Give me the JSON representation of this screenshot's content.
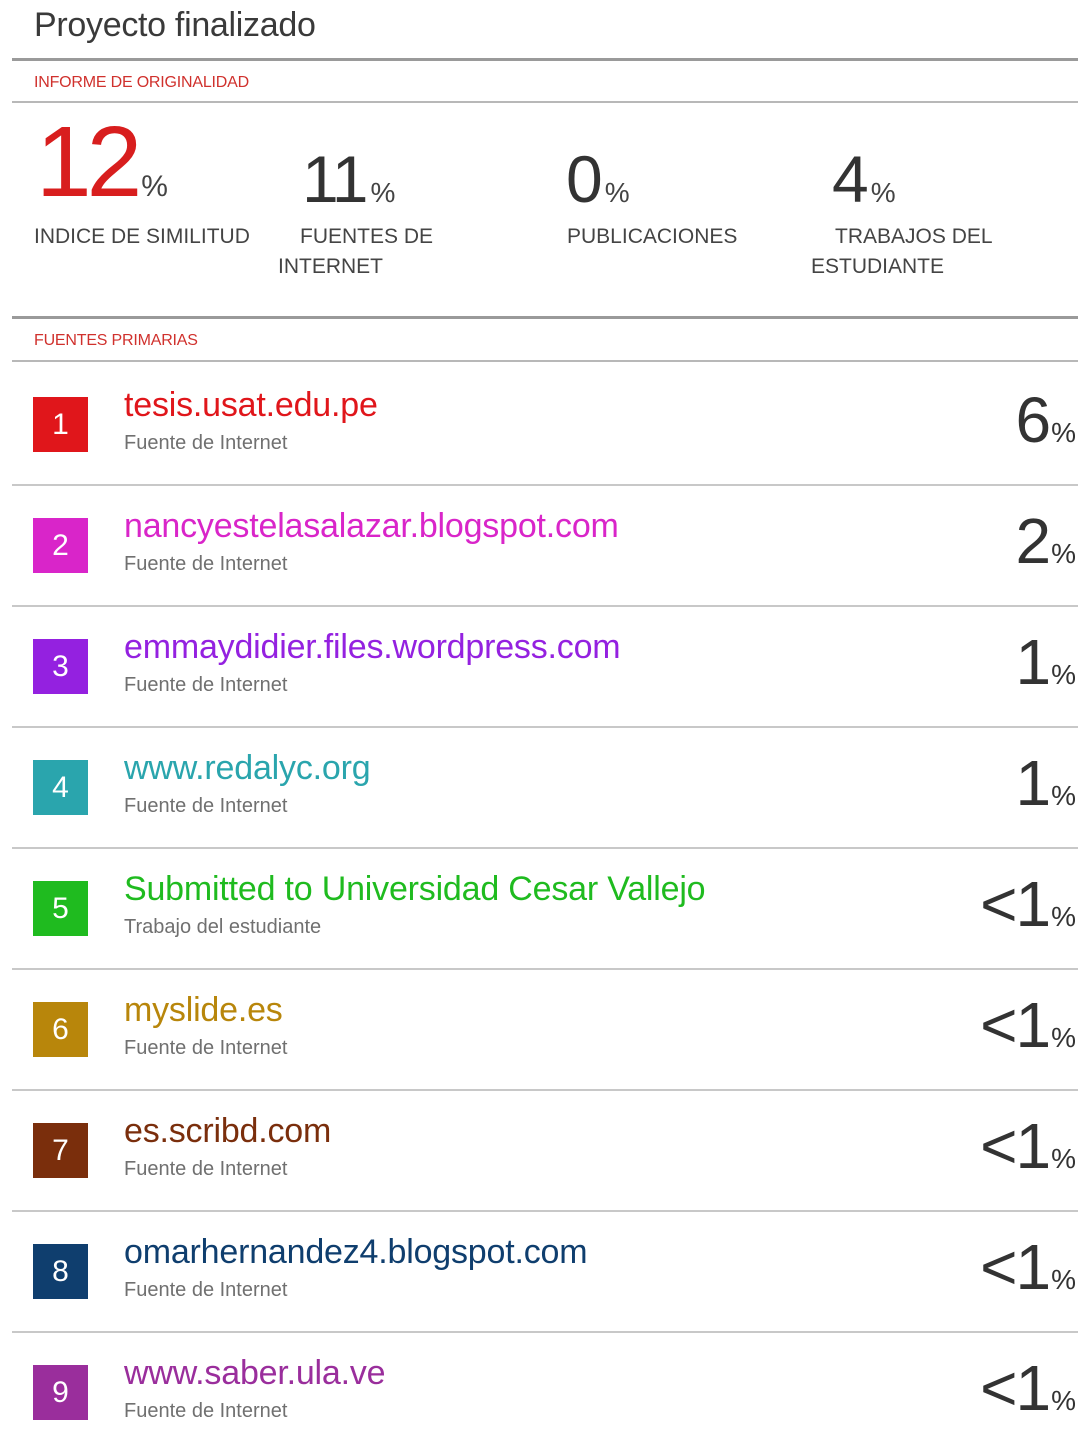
{
  "title": "Proyecto finalizado",
  "report_label": "INFORME DE ORIGINALIDAD",
  "stats": {
    "similarity": {
      "value": "12",
      "unit": "%",
      "label": "INDICE DE SIMILITUD"
    },
    "internet": {
      "value": "11",
      "unit": "%",
      "label_line1": "FUENTES DE",
      "label_line2": "INTERNET"
    },
    "publications": {
      "value": "0",
      "unit": "%",
      "label": "PUBLICACIONES"
    },
    "student": {
      "value": "4",
      "unit": "%",
      "label_line1": "TRABAJOS DEL",
      "label_line2": "ESTUDIANTE"
    }
  },
  "primary_label": "FUENTES PRIMARIAS",
  "sources": [
    {
      "rank": "1",
      "name": "tesis.usat.edu.pe",
      "type": "Fuente de Internet",
      "value": "6",
      "unit": "%",
      "color": "#e0161b"
    },
    {
      "rank": "2",
      "name": "nancyestelasalazar.blogspot.com",
      "type": "Fuente de Internet",
      "value": "2",
      "unit": "%",
      "color": "#d925c9"
    },
    {
      "rank": "3",
      "name": "emmaydidier.files.wordpress.com",
      "type": "Fuente de Internet",
      "value": "1",
      "unit": "%",
      "color": "#9421e0"
    },
    {
      "rank": "4",
      "name": "www.redalyc.org",
      "type": "Fuente de Internet",
      "value": "1",
      "unit": "%",
      "color": "#2aa5ad"
    },
    {
      "rank": "5",
      "name": "Submitted to Universidad Cesar Vallejo",
      "type": "Trabajo del estudiante",
      "value": "<1",
      "unit": "%",
      "color": "#1fbb1f"
    },
    {
      "rank": "6",
      "name": "myslide.es",
      "type": "Fuente de Internet",
      "value": "<1",
      "unit": "%",
      "color": "#b8860b"
    },
    {
      "rank": "7",
      "name": "es.scribd.com",
      "type": "Fuente de Internet",
      "value": "<1",
      "unit": "%",
      "color": "#7a2e0c"
    },
    {
      "rank": "8",
      "name": "omarhernandez4.blogspot.com",
      "type": "Fuente de Internet",
      "value": "<1",
      "unit": "%",
      "color": "#0f3e6e"
    },
    {
      "rank": "9",
      "name": "www.saber.ula.ve",
      "type": "Fuente de Internet",
      "value": "<1",
      "unit": "%",
      "color": "#9a2e9c"
    }
  ]
}
